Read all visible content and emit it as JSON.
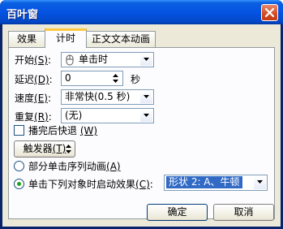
{
  "window": {
    "title": "百叶窗"
  },
  "tabs": [
    {
      "label": "效果"
    },
    {
      "label": "计时"
    },
    {
      "label": "正文文本动画"
    }
  ],
  "timing": {
    "start": {
      "label": "开始",
      "key": "(S)",
      "value": "单击时",
      "icon": "mouse-icon"
    },
    "delay": {
      "label": "延迟",
      "key": "(D)",
      "value": "0",
      "unit": "秒"
    },
    "speed": {
      "label": "速度",
      "key": "(E)",
      "value": "非常快(0.5 秒)"
    },
    "repeat": {
      "label": "重复",
      "key": "(R)",
      "value": "(无)"
    },
    "rewind": {
      "label": "播完后快退",
      "key": "(W)",
      "checked": false
    },
    "triggers": {
      "label": "触发器",
      "key": "(T)"
    },
    "option_sequence": {
      "label": "部分单击序列动画",
      "key": "(A)",
      "selected": false
    },
    "option_click": {
      "label": "单击下列对象时启动效果",
      "key": "(C)",
      "selected": true,
      "value": "形状 2: A、牛顿"
    }
  },
  "buttons": {
    "ok": "确定",
    "cancel": "取消"
  },
  "colors": {
    "titlebar": "#0554e3",
    "face": "#ece9d8",
    "selection": "#316ac5"
  }
}
